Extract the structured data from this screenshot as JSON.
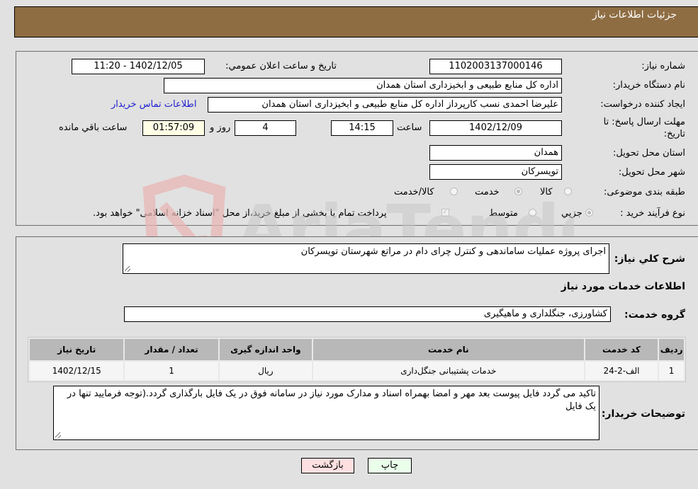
{
  "header": {
    "title": "جزئیات اطلاعات نیاز"
  },
  "details": {
    "need_number": {
      "label": "شماره نیاز:",
      "value": "1102003137000146"
    },
    "announce_datetime": {
      "label": "تاريخ و ساعت اعلان عمومي:",
      "value": "1402/12/05 - 11:20"
    },
    "buyer_org": {
      "label": "نام دستگاه خريدار:",
      "value": "اداره كل منابع طبيعی و ابخيزداری استان همدان"
    },
    "requester": {
      "label": "ايجاد كننده درخواست:",
      "value": "عليرضا احمدی نسب كارپرداز اداره كل منابع طبيعی و ابخيزداری استان همدان"
    },
    "buyer_contact_link": "اطلاعات تماس خريدار",
    "deadline": {
      "label_line1": "مهلت ارسال پاسخ: تا",
      "label_line2": "تاریخ:",
      "date": "1402/12/09",
      "time_label": "ساعت",
      "time": "14:15",
      "days": "4",
      "days_label": "روز و",
      "remaining": "01:57:09",
      "remaining_label": "ساعت باقي مانده"
    },
    "delivery_province": {
      "label": "استان محل تحويل:",
      "value": "همدان"
    },
    "delivery_city": {
      "label": "شهر محل تحويل:",
      "value": "تویسرکان"
    },
    "category": {
      "label": "طبقه بندی موضوعی:",
      "options": [
        "كالا",
        "خدمت",
        "كالا/خدمت"
      ],
      "selected": "خدمت"
    },
    "purchase_type": {
      "label": "نوع فرآيند خريد :",
      "options": [
        "جزيي",
        "متوسط"
      ],
      "selected": "جزيي",
      "treasury_note": "پرداخت تمام يا بخشی از مبلغ خريد،از محل \"اسناد خزانه اسلامی\" خواهد بود."
    }
  },
  "summary": {
    "description_label": "شرح كلي نياز:",
    "description": "اجرای پروژه عملیات ساماندهی و کنترل چرای دام در مراتع شهرستان تویسرکان",
    "services_title": "اطلاعات خدمات مورد نياز",
    "service_group_label": "گروه خدمت:",
    "service_group": "کشاورزی، جنگلداری و ماهیگیری",
    "table": {
      "headers": [
        "رديف",
        "كد خدمت",
        "نام خدمت",
        "واحد اندازه گيری",
        "تعداد / مقدار",
        "تاريخ نياز"
      ],
      "rows": [
        [
          "1",
          "الف-2-24",
          "خدمات پشتیبانی جنگل‌داری",
          "ریال",
          "1",
          "1402/12/15"
        ]
      ]
    },
    "buyer_notes_label": "توضيحات خريدار:",
    "buyer_notes": "تاکید می گردد فایل پیوست بعد مهر و امضا بهمراه اسناد و مدارک مورد نیاز در سامانه فوق در یک فایل بارگذاری گردد.(توجه فرمایید تنها در یک فایل"
  },
  "buttons": {
    "print": "چاپ",
    "back": "بازگشت"
  },
  "watermark": {
    "text": "AriaTender.net"
  }
}
